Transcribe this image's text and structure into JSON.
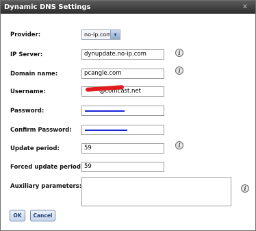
{
  "dialog": {
    "title": "Dynamic DNS Settings",
    "close_glyph": "x"
  },
  "form": {
    "provider": {
      "label": "Provider:",
      "value": "no-ip.com"
    },
    "ip_server": {
      "label": "IP Server:",
      "value": "dynupdate.no-ip.com"
    },
    "domain_name": {
      "label": "Domain name:",
      "value": "pcangle.com"
    },
    "username": {
      "label": "Username:",
      "value": "@comcast.net"
    },
    "password": {
      "label": "Password:"
    },
    "confirm_password": {
      "label": "Confirm Password:"
    },
    "update_period": {
      "label": "Update period:",
      "value": "59"
    },
    "forced_update_period": {
      "label": "Forced update period:",
      "value": "59"
    },
    "auxiliary_parameters": {
      "label": "Auxiliary parameters:",
      "value": ""
    }
  },
  "info_glyph": "i",
  "select_arrow": "▾",
  "buttons": {
    "ok": "OK",
    "cancel": "Cancel"
  },
  "colors": {
    "title_bar": "#3a3a3a",
    "button_text": "#1d3f74",
    "password_mask": "#1622d8",
    "redaction": "#e01b1b"
  }
}
